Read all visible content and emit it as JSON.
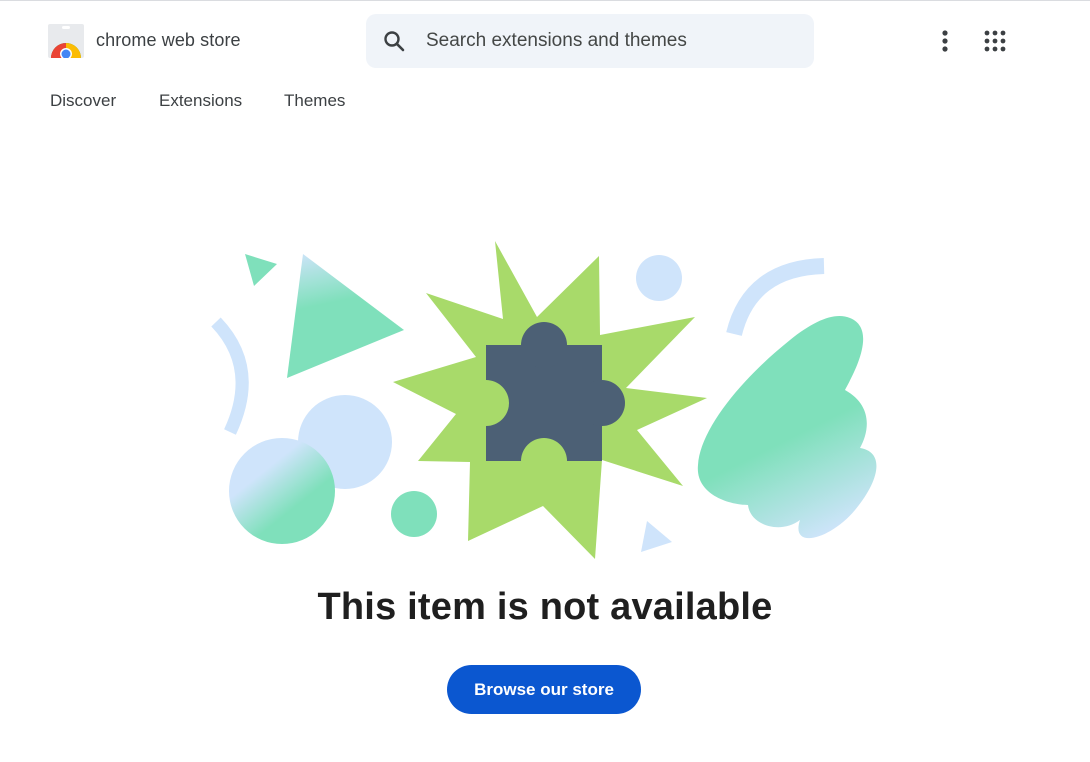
{
  "header": {
    "brand": "chrome web store",
    "search": {
      "placeholder": "Search extensions and themes",
      "value": ""
    },
    "icons": {
      "logo": "chrome-web-store-logo",
      "search": "search-icon",
      "more": "more-vert-icon",
      "apps": "apps-grid-icon"
    }
  },
  "nav": {
    "items": [
      {
        "label": "Discover"
      },
      {
        "label": "Extensions"
      },
      {
        "label": "Themes"
      }
    ]
  },
  "main": {
    "title": "This item is not available",
    "cta_label": "Browse our store",
    "illustration": "puzzle-piece-burst"
  },
  "colors": {
    "accent": "#0b57d0",
    "burst_green": "#a8da6a",
    "mint": "#7fe0bb",
    "light_blue": "#cfe4fb",
    "puzzle": "#4c6075"
  }
}
